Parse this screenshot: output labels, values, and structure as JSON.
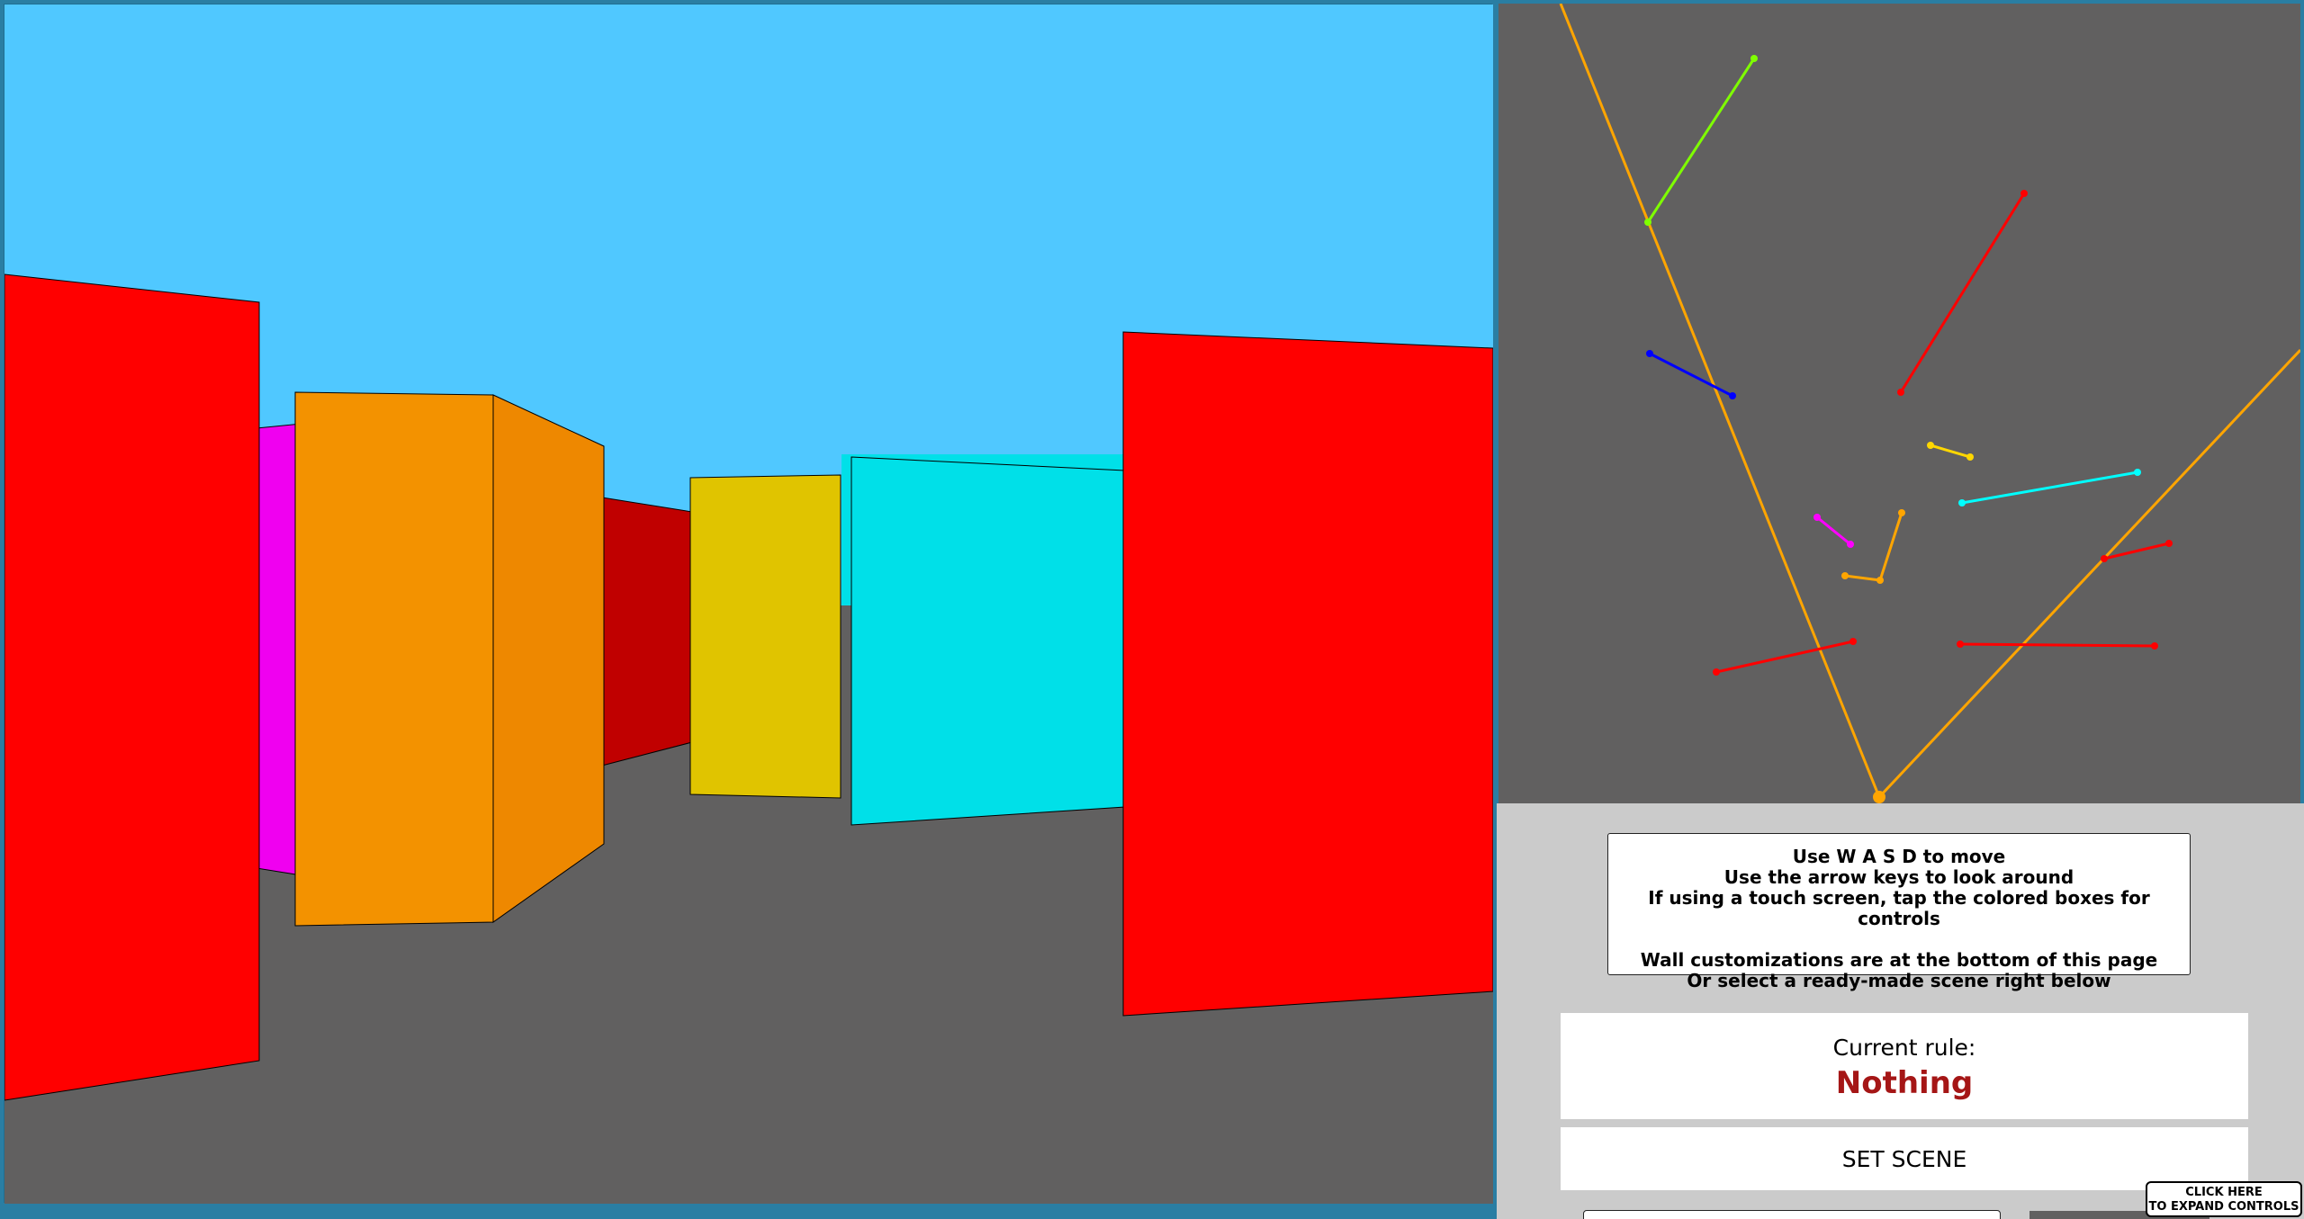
{
  "scene": {
    "sky_color": "#50c8ff",
    "floor_color": "#616060",
    "walls": [
      {
        "name": "left-red",
        "color": "#ff0000"
      },
      {
        "name": "magenta",
        "color": "#f000f0"
      },
      {
        "name": "orange-front",
        "color": "#f39200"
      },
      {
        "name": "orange-side",
        "color": "#ee8800"
      },
      {
        "name": "dark-red",
        "color": "#c00000"
      },
      {
        "name": "yellow",
        "color": "#e0c400"
      },
      {
        "name": "cyan",
        "color": "#00e0e8"
      },
      {
        "name": "right-red",
        "color": "#ff0000"
      }
    ]
  },
  "minimap": {
    "background": "#616060",
    "player_color": "#ffa500",
    "segment_colors": [
      "#7fff00",
      "#ff0000",
      "#0000ff",
      "#ffd700",
      "#00ffff",
      "#ff00ff",
      "#ffa500"
    ]
  },
  "instructions": {
    "line1": "Use W A S D to move",
    "line2": "Use the arrow keys to look around",
    "line3": "If using a touch screen, tap the colored boxes for controls",
    "line4": "",
    "line5": "Wall customizations are at the bottom of this page",
    "line6": "Or select a ready-made scene right below"
  },
  "rule": {
    "label": "Current rule:",
    "value": "Nothing",
    "value_color": "#a51616"
  },
  "set_scene_label": "SET SCENE",
  "expand_controls": {
    "line1": "CLICK HERE",
    "line2": "TO EXPAND CONTROLS"
  }
}
